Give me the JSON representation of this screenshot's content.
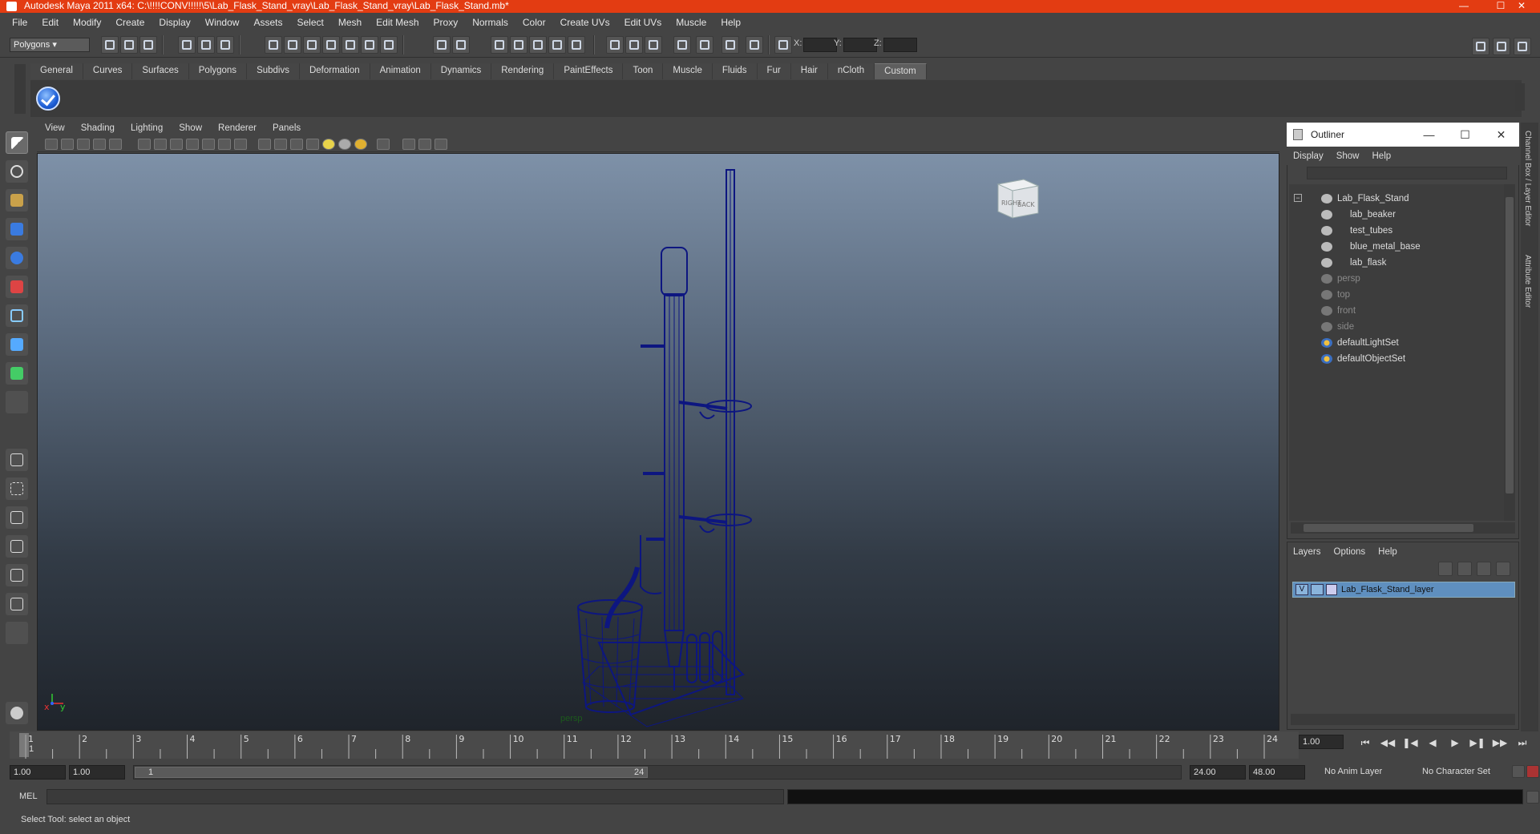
{
  "window": {
    "title": "Autodesk Maya 2011 x64: C:\\!!!!CONV!!!!!\\5\\Lab_Flask_Stand_vray\\Lab_Flask_Stand_vray\\Lab_Flask_Stand.mb*"
  },
  "menubar": [
    "File",
    "Edit",
    "Modify",
    "Create",
    "Display",
    "Window",
    "Assets",
    "Select",
    "Mesh",
    "Edit Mesh",
    "Proxy",
    "Normals",
    "Color",
    "Create UVs",
    "Edit UVs",
    "Muscle",
    "Help"
  ],
  "status": {
    "mode": "Polygons",
    "x_label": "X:",
    "y_label": "Y:",
    "z_label": "Z:"
  },
  "shelf": {
    "tabs": [
      "General",
      "Curves",
      "Surfaces",
      "Polygons",
      "Subdivs",
      "Deformation",
      "Animation",
      "Dynamics",
      "Rendering",
      "PaintEffects",
      "Toon",
      "Muscle",
      "Fluids",
      "Fur",
      "Hair",
      "nCloth",
      "Custom"
    ],
    "active": "Custom"
  },
  "panel": {
    "menu": [
      "View",
      "Shading",
      "Lighting",
      "Show",
      "Renderer",
      "Panels"
    ],
    "camera_label": "persp",
    "viewcube": {
      "left": "RIGHT",
      "right": "BACK"
    },
    "axis": {
      "x": "x",
      "y": "y"
    }
  },
  "outliner": {
    "title": "Outliner",
    "menu": [
      "Display",
      "Show",
      "Help"
    ],
    "items": [
      {
        "label": "Lab_Flask_Stand",
        "indent": 0,
        "dim": false
      },
      {
        "label": "lab_beaker",
        "indent": 1,
        "dim": false
      },
      {
        "label": "test_tubes",
        "indent": 1,
        "dim": false
      },
      {
        "label": "blue_metal_base",
        "indent": 1,
        "dim": false
      },
      {
        "label": "lab_flask",
        "indent": 1,
        "dim": false
      },
      {
        "label": "persp",
        "indent": 0,
        "dim": true
      },
      {
        "label": "top",
        "indent": 0,
        "dim": true
      },
      {
        "label": "front",
        "indent": 0,
        "dim": true
      },
      {
        "label": "side",
        "indent": 0,
        "dim": true
      },
      {
        "label": "defaultLightSet",
        "indent": 0,
        "dim": false
      },
      {
        "label": "defaultObjectSet",
        "indent": 0,
        "dim": false
      }
    ]
  },
  "layers": {
    "menu": [
      "Layers",
      "Options",
      "Help"
    ],
    "row": {
      "visible": "V",
      "label": "Lab_Flask_Stand_layer"
    }
  },
  "sidetabs": [
    "Channel Box / Layer Editor",
    "Attribute Editor"
  ],
  "timeline": {
    "ticks": [
      "1",
      "2",
      "3",
      "4",
      "5",
      "6",
      "7",
      "8",
      "9",
      "10",
      "11",
      "12",
      "13",
      "14",
      "15",
      "16",
      "17",
      "18",
      "19",
      "20",
      "21",
      "22",
      "23",
      "24"
    ],
    "current_frame_marker": "1",
    "current_frame": "1.00"
  },
  "range": {
    "start": "1.00",
    "start2": "1.00",
    "slider_start": "1",
    "slider_end": "24",
    "end": "24.00",
    "end2": "48.00",
    "anim_layer": "No Anim Layer",
    "char_set": "No Character Set"
  },
  "cmd": {
    "label": "MEL"
  },
  "help": {
    "text": "Select Tool: select an object"
  },
  "colors": {
    "titlebar": "#e33c12",
    "wireframe": "#0d1680",
    "layer_selected": "#5f8fbf"
  }
}
